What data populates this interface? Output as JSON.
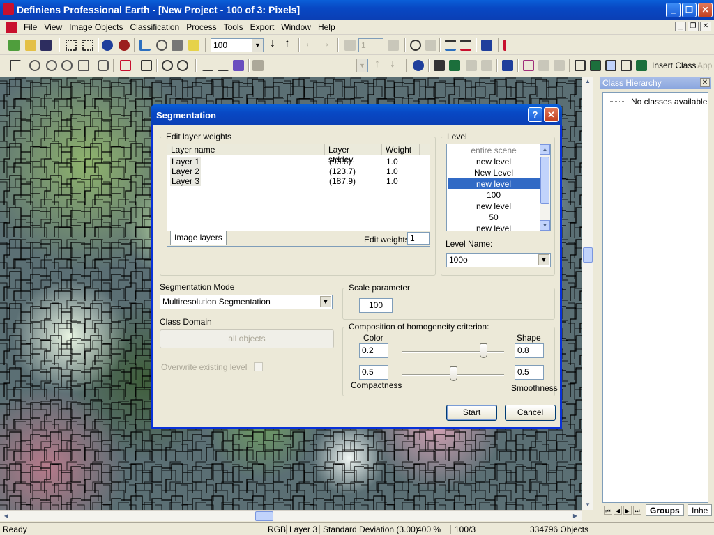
{
  "window": {
    "title": "Definiens Professional Earth - [New Project - 100 of 3: Pixels]",
    "min_label": "_",
    "max_label": "❐",
    "close_label": "✕"
  },
  "menu": {
    "items": [
      "File",
      "View",
      "Image Objects",
      "Classification",
      "Process",
      "Tools",
      "Export",
      "Window",
      "Help"
    ]
  },
  "toolbar": {
    "zoom_value": "100",
    "level_value": "1",
    "insert_class": "Insert Class",
    "app_label": "App"
  },
  "class_pane": {
    "title": "Class Hierarchy",
    "empty_text": "No classes available",
    "tabs": [
      "Groups",
      "Inhe"
    ]
  },
  "status": {
    "ready": "Ready",
    "mode": "RGB",
    "layer": "Layer 3",
    "info": "Standard Deviation (3.00)",
    "zoom": "400 %",
    "level": "100/3",
    "objects": "334796 Objects"
  },
  "dialog": {
    "title": "Segmentation",
    "help_label": "?",
    "close_label": "✕",
    "layer_weights": {
      "group_label": "Edit layer weights",
      "columns": [
        "Layer name",
        "Layer stddev.",
        "Weight"
      ],
      "rows": [
        {
          "name": "Layer 1",
          "stddev": "(93.6)",
          "weight": "1.0"
        },
        {
          "name": "Layer 2",
          "stddev": "(123.7)",
          "weight": "1.0"
        },
        {
          "name": "Layer 3",
          "stddev": "(187.9)",
          "weight": "1.0"
        }
      ],
      "tab_label": "Image layers",
      "edit_weights_label": "Edit weights:",
      "edit_weights_value": "1"
    },
    "level": {
      "group_label": "Level",
      "items": [
        "entire scene",
        "new level",
        "New Level",
        "new level",
        "100",
        "new level",
        "50",
        "new level"
      ],
      "selected_index": 3,
      "name_label": "Level Name:",
      "name_value": "100o"
    },
    "segmentation_mode": {
      "label": "Segmentation Mode",
      "value": "Multiresolution Segmentation"
    },
    "class_domain": {
      "label": "Class Domain",
      "button": "all objects"
    },
    "overwrite_label": "Overwrite existing level",
    "scale": {
      "group_label": "Scale parameter",
      "value": "100"
    },
    "homogeneity": {
      "group_label": "Composition of homogeneity criterion:",
      "color_label": "Color",
      "shape_label": "Shape",
      "color_value": "0.2",
      "shape_value": "0.8",
      "shape_fraction": 0.8,
      "compactness_label": "Compactness",
      "smoothness_label": "Smoothness",
      "compactness_value": "0.5",
      "smoothness_value": "0.5",
      "smoothness_fraction": 0.5
    },
    "start_button": "Start",
    "cancel_button": "Cancel"
  },
  "colors": {
    "title_blue": "#0a5fd8",
    "selection": "#316ac5"
  }
}
